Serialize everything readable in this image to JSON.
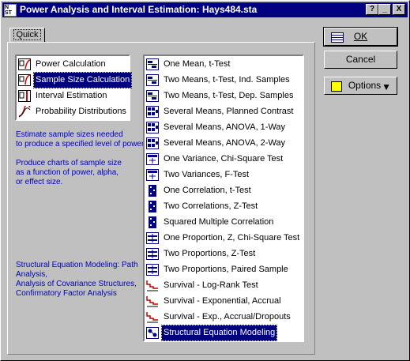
{
  "window": {
    "title": "Power Analysis and Interval Estimation: Hays484.sta"
  },
  "caption_buttons": {
    "help": "?",
    "minimize": "_",
    "close": "X"
  },
  "tab": {
    "label": "Quick"
  },
  "categories": [
    {
      "label": "Power Calculation",
      "icon": "power-calc-icon",
      "selected": false
    },
    {
      "label": "Sample Size Calculation",
      "icon": "sample-size-icon",
      "selected": true
    },
    {
      "label": "Interval Estimation",
      "icon": "interval-icon",
      "selected": false
    },
    {
      "label": "Probability Distributions",
      "icon": "distribution-icon",
      "selected": false
    }
  ],
  "description": {
    "line1": "Estimate sample sizes needed",
    "line2": "to produce a specified level of power.",
    "line3": "Produce charts of sample size",
    "line4": "as a function of power, alpha,",
    "line5": "or effect size.",
    "line6": "Structural Equation Modeling: Path",
    "line7": "Analysis,",
    "line8": "Analysis of Covariance Structures,",
    "line9": "Confirmatory Factor Analysis"
  },
  "tests": [
    {
      "label": "One Mean, t-Test",
      "icon": "t-test-icon",
      "selected": false
    },
    {
      "label": "Two Means, t-Test, Ind. Samples",
      "icon": "t-test-icon",
      "selected": false
    },
    {
      "label": "Two Means, t-Test, Dep. Samples",
      "icon": "t-test-icon",
      "selected": false
    },
    {
      "label": "Several Means, Planned Contrast",
      "icon": "anova-icon",
      "selected": false
    },
    {
      "label": "Several Means, ANOVA, 1-Way",
      "icon": "anova-icon",
      "selected": false
    },
    {
      "label": "Several Means, ANOVA, 2-Way",
      "icon": "anova-icon",
      "selected": false
    },
    {
      "label": "One Variance, Chi-Square Test",
      "icon": "variance-icon",
      "selected": false
    },
    {
      "label": "Two Variances, F-Test",
      "icon": "variance-icon",
      "selected": false
    },
    {
      "label": "One Correlation, t-Test",
      "icon": "correlation-icon",
      "selected": false
    },
    {
      "label": "Two Correlations, Z-Test",
      "icon": "correlation-icon",
      "selected": false
    },
    {
      "label": "Squared Multiple Correlation",
      "icon": "correlation-icon",
      "selected": false
    },
    {
      "label": "One Proportion, Z, Chi-Square Test",
      "icon": "proportion-icon",
      "selected": false
    },
    {
      "label": "Two Proportions, Z-Test",
      "icon": "proportion-icon",
      "selected": false
    },
    {
      "label": "Two Proportions, Paired Sample",
      "icon": "proportion-icon",
      "selected": false
    },
    {
      "label": "Survival - Log-Rank Test",
      "icon": "survival-icon",
      "selected": false
    },
    {
      "label": "Survival - Exponential, Accrual",
      "icon": "survival-icon",
      "selected": false
    },
    {
      "label": "Survival - Exp., Accrual/Dropouts",
      "icon": "survival-icon",
      "selected": false
    },
    {
      "label": "Structural Equation Modeling",
      "icon": "sem-icon",
      "selected": true
    }
  ],
  "buttons": {
    "ok": "OK",
    "cancel": "Cancel",
    "options": "Options"
  },
  "colors": {
    "title_bar": "#000080",
    "selection": "#000080",
    "description_text": "#0000c0",
    "face": "#c0c0c0"
  }
}
